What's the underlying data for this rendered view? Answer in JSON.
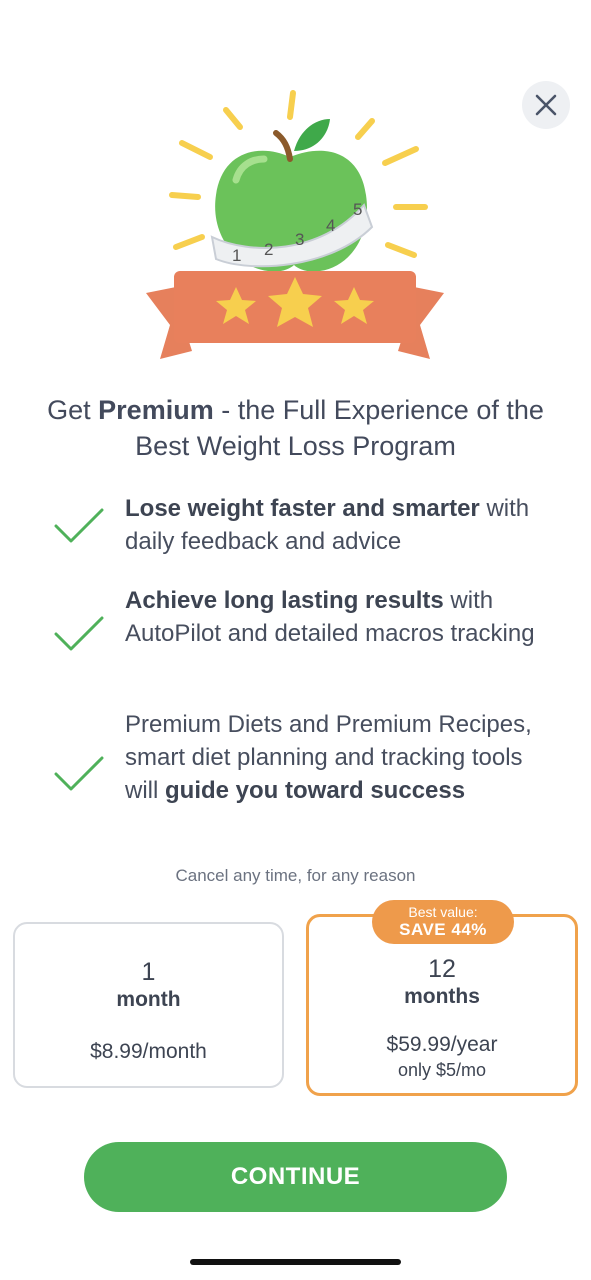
{
  "close": {
    "icon": "close-icon"
  },
  "hero": {
    "icon": "apple-measuring-tape-stars-illustration",
    "tape_numbers": [
      "1",
      "2",
      "3",
      "4",
      "5"
    ]
  },
  "headline": {
    "prefix": "Get ",
    "bold": "Premium",
    "suffix": " - the Full Experience of the Best Weight Loss Program"
  },
  "features": [
    {
      "icon": "check-icon",
      "bold": "Lose weight faster and smarter",
      "text": " with daily feedback and advice"
    },
    {
      "icon": "check-icon",
      "bold": "Achieve long lasting results",
      "text": " with AutoPilot and detailed macros tracking"
    },
    {
      "icon": "check-icon",
      "text": "Premium Diets and Premium Recipes, smart diet planning and tracking tools will ",
      "bold": "guide you toward success"
    }
  ],
  "cancel_note": "Cancel any time, for any reason",
  "plans": [
    {
      "number": "1",
      "unit": "month",
      "price": "$8.99/month",
      "selected": false
    },
    {
      "number": "12",
      "unit": "months",
      "price": "$59.99/year",
      "sub": "only $5/mo",
      "selected": true
    }
  ],
  "badge": {
    "line1": "Best value:",
    "line2": "SAVE 44%"
  },
  "continue_label": "CONTINUE",
  "colors": {
    "accent_green": "#4fb15a",
    "accent_orange": "#f0a24b",
    "text": "#3d4452"
  }
}
